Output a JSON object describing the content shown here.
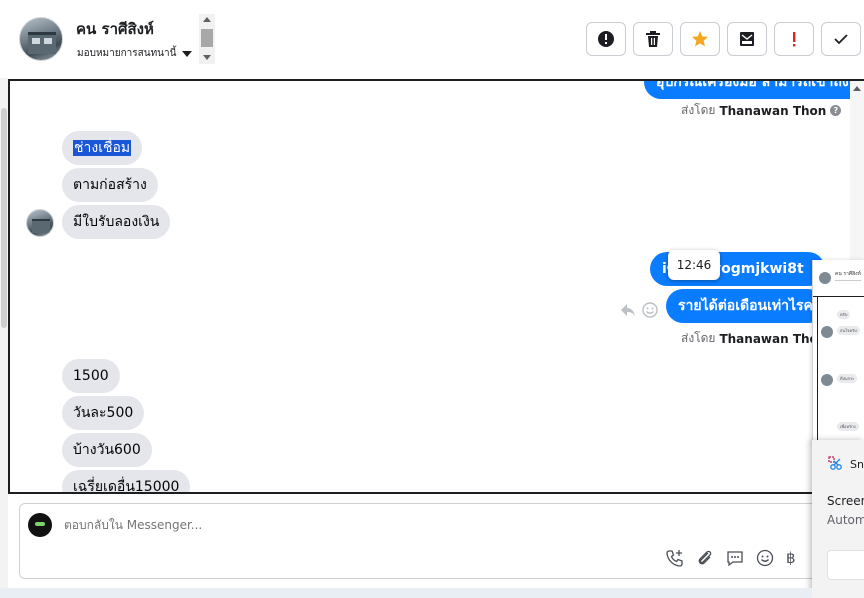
{
  "header": {
    "contact_name": "คน ราศีสิงห์",
    "assign_label": "มอบหมายการสนทนานี้"
  },
  "toolbar": {
    "buttons": [
      {
        "name": "report-spam",
        "icon": "exclamation-circle-icon"
      },
      {
        "name": "delete",
        "icon": "trash-icon"
      },
      {
        "name": "star",
        "icon": "star-icon",
        "color": "#f5a623"
      },
      {
        "name": "move-to-spam",
        "icon": "mail-block-icon"
      },
      {
        "name": "mark-important",
        "icon": "exclamation-icon",
        "color": "#e02424"
      },
      {
        "name": "mark-done",
        "icon": "check-icon"
      }
    ]
  },
  "messages": {
    "top_outgoing_partial": "อุปกรณ์เครื่องมือ สามารถเข้าถึงได้",
    "sent_by_1": {
      "prefix": "ส่งโดย",
      "name": "Thanawan Thon"
    },
    "incoming_group_1": [
      "ช่างเชื่อม",
      "ตามก่อสร้าง",
      "มีใบรับลองเงิน"
    ],
    "incoming_group_1_highlight": "ช่างเชื่อม",
    "outgoing_1": "iขั้นgfnvogmjkwi8t",
    "tooltip_time": "12:46",
    "outgoing_2": "รายได้ต่อเดือนเท่าไรคะ",
    "sent_by_2": {
      "prefix": "ส่งโดย",
      "name": "Thanawan Thon"
    },
    "incoming_group_2": [
      "1500",
      "วันละ500",
      "บ้างวัน600",
      "เฉรี่ยเดอื่น15000"
    ]
  },
  "composer": {
    "placeholder": "ตอบกลับใน Messenger..."
  },
  "overlay_thumb": {
    "name": "คน ราศีสิงห์",
    "chips": [
      "ครับ",
      "สนใจครับ",
      "ดีสมกระ",
      "เพื่อหรักง"
    ]
  },
  "snip_panel": {
    "title": "Snipping Tool",
    "line1": "Screenshot copied to clipboard",
    "line2": "Automatically saved to screenshots folder"
  }
}
